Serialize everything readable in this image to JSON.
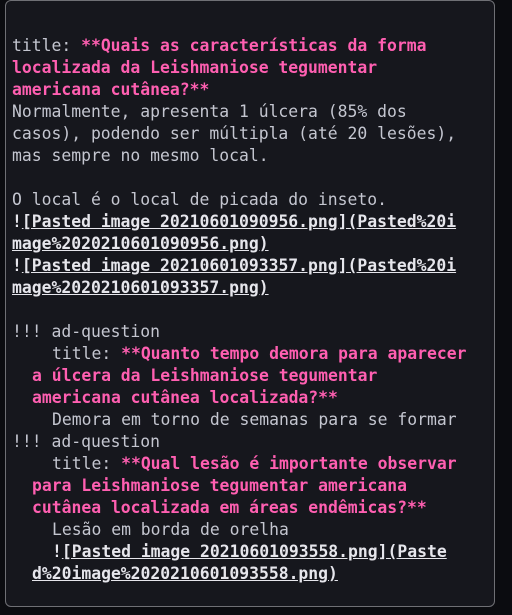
{
  "note": {
    "title_prefix": "title: ",
    "title_lines": [
      "**Quais as características da forma",
      "localizada da Leishmaniose tegumentar",
      "americana cutânea?**"
    ],
    "body_lines": [
      "Normalmente, apresenta 1 úlcera (85% dos",
      "casos), podendo ser múltipla (até 20 lesões),",
      "mas sempre no mesmo local."
    ],
    "local_line": "O local é o local de picada do inseto.",
    "image_links": [
      [
        "[Pasted image 20210601090956.png](Pasted%20i",
        "mage%2020210601090956.png)"
      ],
      [
        "[Pasted image 20210601093357.png](Pasted%20i",
        "mage%2020210601093357.png)"
      ]
    ],
    "bang": "!",
    "questions": [
      {
        "header": "!!! ad-question",
        "title_prefix": "title: ",
        "title_lines": [
          "**Quanto tempo demora para aparecer",
          "a úlcera da Leishmaniose tegumentar",
          "americana cutânea localizada?**"
        ],
        "answer": "Demora em torno de semanas para se formar"
      },
      {
        "header": "!!! ad-question",
        "title_prefix": "title: ",
        "title_lines": [
          "**Qual lesão é importante observar",
          "para Leishmaniose tegumentar americana",
          "cutânea localizada em áreas endêmicas?**"
        ],
        "answer": "Lesão em borda de orelha",
        "image_link": [
          "[Pasted image 20210601093558.png](Paste",
          "d%20image%2020210601093558.png)"
        ]
      }
    ]
  },
  "colors": {
    "background": "#16171d",
    "title_accent": "#ff5fb1",
    "text": "#c4c6d0"
  }
}
